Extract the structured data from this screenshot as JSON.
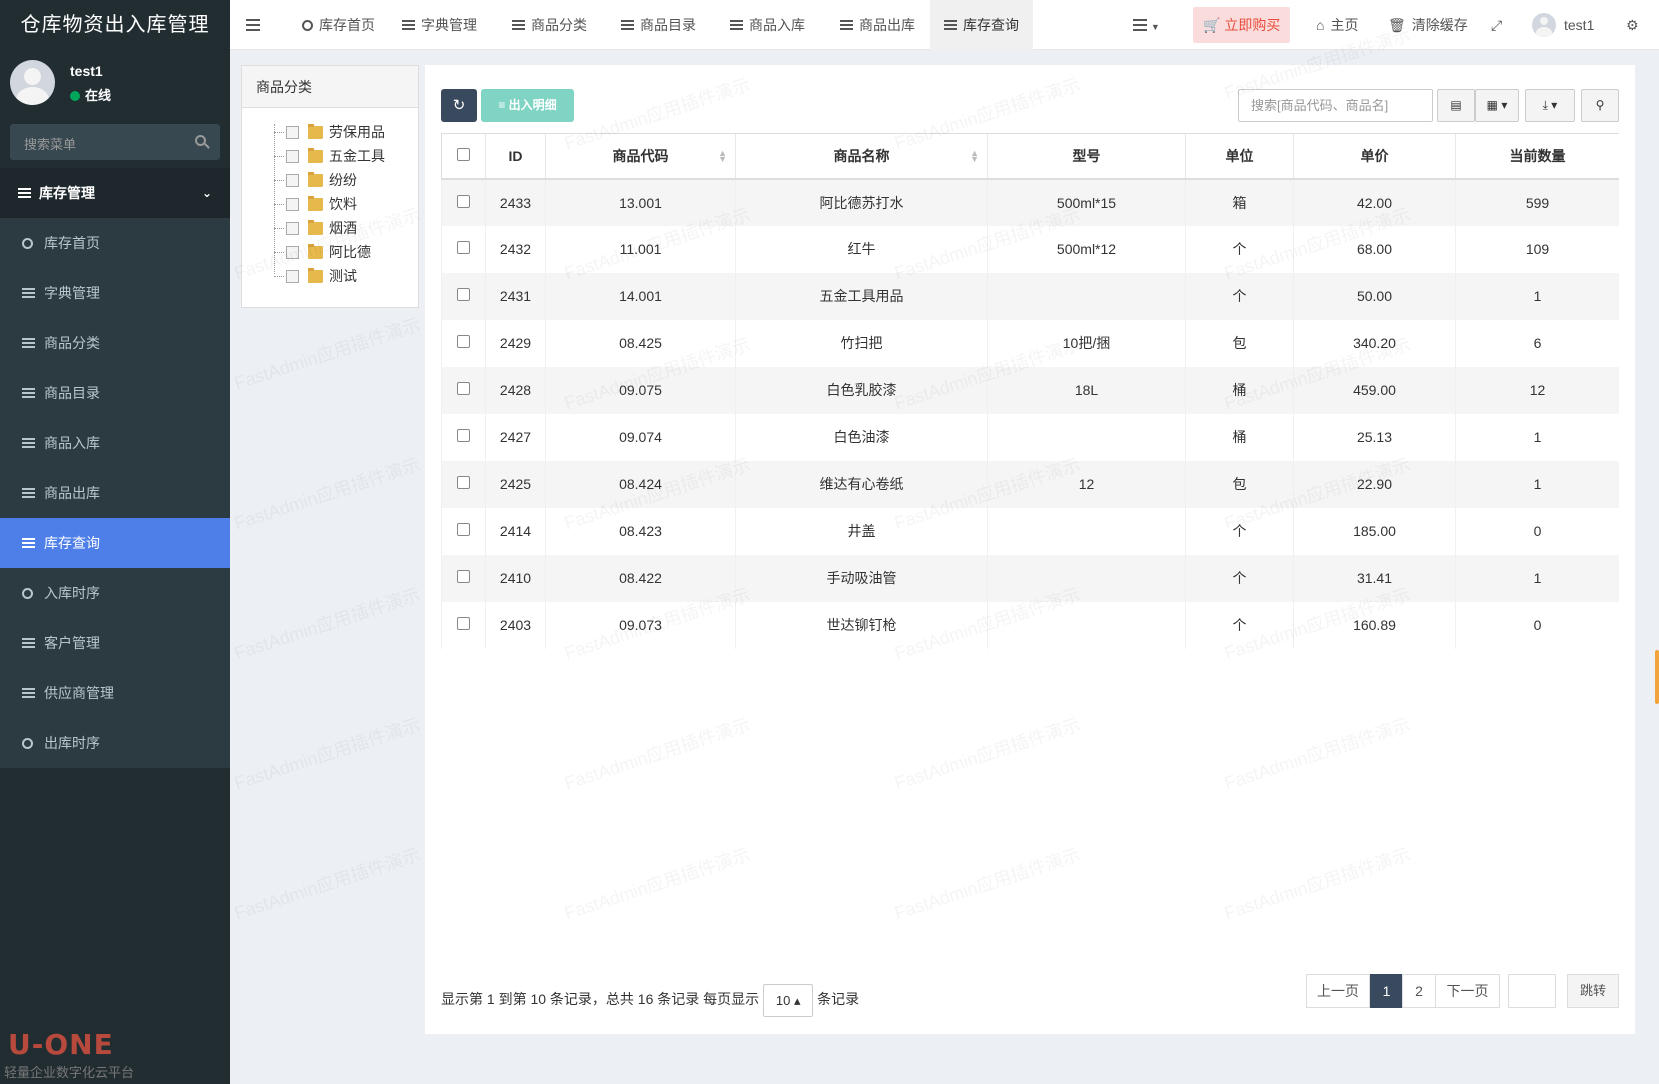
{
  "app": {
    "title": "仓库物资出入库管理"
  },
  "user": {
    "name": "test1",
    "status": "在线"
  },
  "sidebar": {
    "search_placeholder": "搜索菜单",
    "section": "库存管理",
    "items": [
      {
        "label": "库存首页",
        "icon": "circle-icon"
      },
      {
        "label": "字典管理",
        "icon": "list-icon"
      },
      {
        "label": "商品分类",
        "icon": "list-icon"
      },
      {
        "label": "商品目录",
        "icon": "list-icon"
      },
      {
        "label": "商品入库",
        "icon": "list-icon"
      },
      {
        "label": "商品出库",
        "icon": "list-icon"
      },
      {
        "label": "库存查询",
        "icon": "list-icon",
        "active": true
      },
      {
        "label": "入库时序",
        "icon": "circle-icon"
      },
      {
        "label": "客户管理",
        "icon": "list-icon"
      },
      {
        "label": "供应商管理",
        "icon": "list-icon"
      },
      {
        "label": "出库时序",
        "icon": "circle-icon"
      }
    ]
  },
  "topbar": {
    "tabs": [
      "库存首页",
      "字典管理",
      "商品分类",
      "商品目录",
      "商品入库",
      "商品出库",
      "库存查询"
    ],
    "active_tab": "库存查询",
    "buy": "立即购买",
    "home": "主页",
    "clear_cache": "清除缓存",
    "user": "test1"
  },
  "tree": {
    "title": "商品分类",
    "nodes": [
      "劳保用品",
      "五金工具",
      "纷纷",
      "饮料",
      "烟酒",
      "阿比德",
      "测试"
    ]
  },
  "toolbar": {
    "detail_label": "出入明细",
    "search_placeholder": "搜索[商品代码、商品名]"
  },
  "table": {
    "headers": [
      "ID",
      "商品代码",
      "商品名称",
      "型号",
      "单位",
      "单价",
      "当前数量"
    ],
    "rows": [
      [
        "2433",
        "13.001",
        "阿比德苏打水",
        "500ml*15",
        "箱",
        "42.00",
        "599"
      ],
      [
        "2432",
        "11.001",
        "红牛",
        "500ml*12",
        "个",
        "68.00",
        "109"
      ],
      [
        "2431",
        "14.001",
        "五金工具用品",
        "",
        "个",
        "50.00",
        "1"
      ],
      [
        "2429",
        "08.425",
        "竹扫把",
        "10把/捆",
        "包",
        "340.20",
        "6"
      ],
      [
        "2428",
        "09.075",
        "白色乳胶漆",
        "18L",
        "桶",
        "459.00",
        "12"
      ],
      [
        "2427",
        "09.074",
        "白色油漆",
        "",
        "桶",
        "25.13",
        "1"
      ],
      [
        "2425",
        "08.424",
        "维达有心卷纸",
        "12",
        "包",
        "22.90",
        "1"
      ],
      [
        "2414",
        "08.423",
        "井盖",
        "",
        "个",
        "185.00",
        "0"
      ],
      [
        "2410",
        "08.422",
        "手动吸油管",
        "",
        "个",
        "31.41",
        "1"
      ],
      [
        "2403",
        "09.073",
        "世达铆钉枪",
        "",
        "个",
        "160.89",
        "0"
      ]
    ]
  },
  "pagination": {
    "info": "显示第 1 到第 10 条记录，总共 16 条记录 每页显示",
    "page_size": "10",
    "suffix": "条记录",
    "prev": "上一页",
    "pages": [
      "1",
      "2"
    ],
    "current": "1",
    "next": "下一页",
    "jump": "跳转"
  },
  "watermark": "FastAdmin应用插件演示",
  "logo": {
    "brand": "U-ONE",
    "tagline": "轻量企业数字化云平台"
  }
}
